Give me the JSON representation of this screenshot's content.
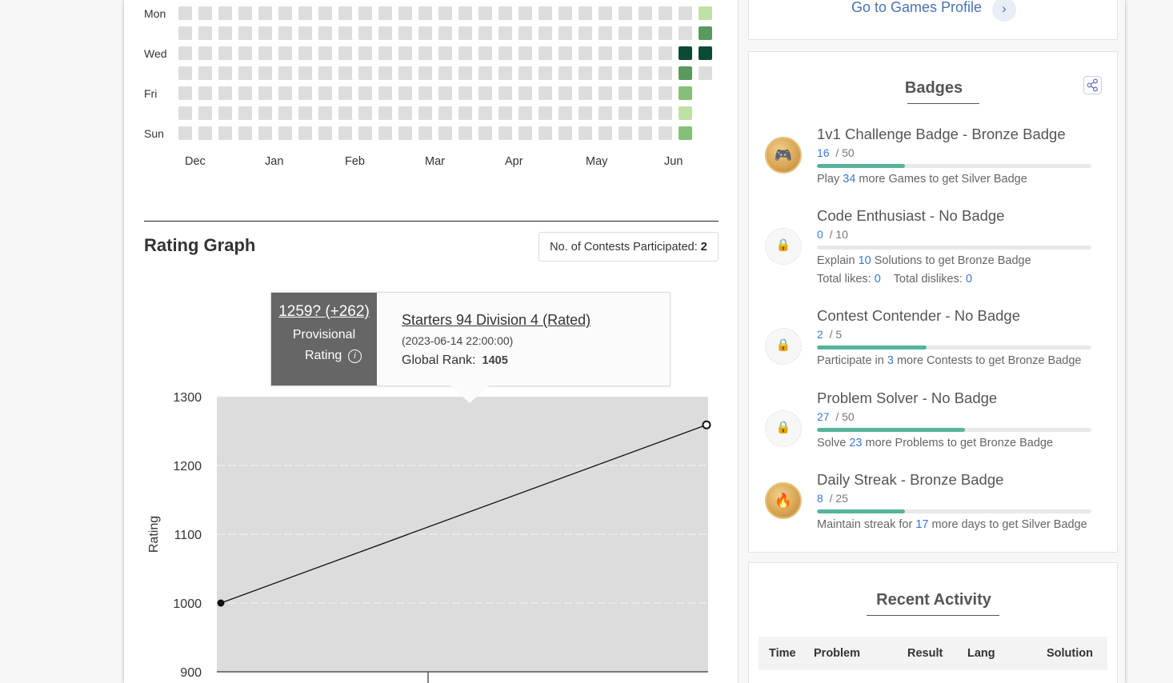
{
  "heatmap": {
    "day_labels": [
      {
        "row": 0,
        "label": "Mon"
      },
      {
        "row": 2,
        "label": "Wed"
      },
      {
        "row": 4,
        "label": "Fri"
      },
      {
        "row": 6,
        "label": "Sun"
      }
    ],
    "month_labels": [
      "Dec",
      "Jan",
      "Feb",
      "Mar",
      "Apr",
      "May",
      "Jun"
    ],
    "active_cells": [
      {
        "col": 26,
        "row": 0,
        "level": 1
      },
      {
        "col": 26,
        "row": 1,
        "level": 3
      },
      {
        "col": 26,
        "row": 2,
        "level": 4
      },
      {
        "col": 25,
        "row": 2,
        "level": 4
      },
      {
        "col": 25,
        "row": 3,
        "level": 3
      },
      {
        "col": 25,
        "row": 4,
        "level": 2
      },
      {
        "col": 25,
        "row": 5,
        "level": 1
      },
      {
        "col": 25,
        "row": 6,
        "level": 2
      }
    ],
    "colors": {
      "empty": "#dddddd",
      "l1": "#bfe0a6",
      "l2": "#86bf78",
      "l3": "#5a9a5e",
      "l4": "#0d4a33"
    }
  },
  "rating_graph": {
    "title": "Rating Graph",
    "contests_label": "No. of Contests Participated:",
    "contests_count": "2",
    "tooltip": {
      "rating": "1259? (+262)",
      "provisional": "Provisional",
      "rating_word": "Rating",
      "info_glyph": "i",
      "contest_name": "Starters 94 Division 4 (Rated)",
      "date": "(2023-06-14 22:00:00)",
      "global_rank_label": "Global Rank:",
      "global_rank": "1405"
    }
  },
  "chart_data": {
    "type": "line",
    "ylabel": "Rating",
    "ylim": [
      900,
      1300
    ],
    "yticks": [
      900,
      1000,
      1100,
      1200,
      1300
    ],
    "series": [
      {
        "values": [
          1000,
          1259
        ]
      }
    ],
    "x": [
      0,
      1
    ],
    "grid": true
  },
  "games_profile": {
    "link": "Go to Games Profile",
    "chevron": "›"
  },
  "badges": {
    "title": "Badges",
    "items": [
      {
        "name": "1v1 Challenge Badge - Bronze Badge",
        "current": "16",
        "total": "/ 50",
        "fraction": 0.32,
        "hint_pre": "Play",
        "hint_num": "34",
        "hint_post": "more Games to get Silver Badge",
        "tier": "bronze",
        "icon": "gamepad-icon",
        "glyph": "🎮"
      },
      {
        "name": "Code Enthusiast - No Badge",
        "current": "0",
        "total": "/ 10",
        "fraction": 0.0,
        "hint_pre": "Explain",
        "hint_num": "10",
        "hint_post": "Solutions to get Bronze Badge",
        "tier": "locked",
        "icon": "lock-icon",
        "glyph": "🔒",
        "likes_label": "Total likes:",
        "likes": "0",
        "dislikes_label": "Total dislikes:",
        "dislikes": "0"
      },
      {
        "name": "Contest Contender - No Badge",
        "current": "2",
        "total": "/ 5",
        "fraction": 0.4,
        "hint_pre": "Participate in",
        "hint_num": "3",
        "hint_post": "more Contests to get Bronze Badge",
        "tier": "locked",
        "icon": "lock-icon",
        "glyph": "🔒"
      },
      {
        "name": "Problem Solver - No Badge",
        "current": "27",
        "total": "/ 50",
        "fraction": 0.54,
        "hint_pre": "Solve",
        "hint_num": "23",
        "hint_post": "more Problems to get Bronze Badge",
        "tier": "locked",
        "icon": "lock-icon",
        "glyph": "🔒"
      },
      {
        "name": "Daily Streak - Bronze Badge",
        "current": "8",
        "total": "/ 25",
        "fraction": 0.32,
        "hint_pre": "Maintain streak for",
        "hint_num": "17",
        "hint_post": "more days to get Silver Badge",
        "tier": "bronze",
        "icon": "flame-icon",
        "glyph": "🔥"
      }
    ]
  },
  "recent_activity": {
    "title": "Recent Activity",
    "columns": [
      "Time",
      "Problem",
      "Result",
      "Lang",
      "Solution"
    ]
  }
}
